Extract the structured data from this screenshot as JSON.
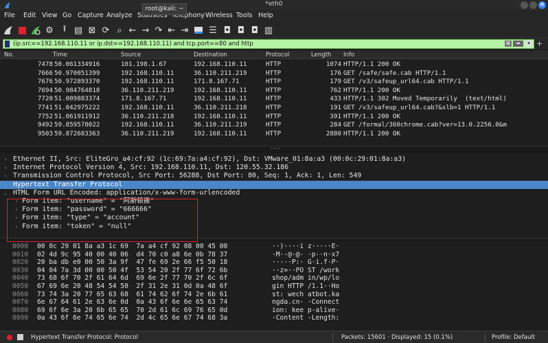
{
  "window": {
    "title": "*eth0",
    "tooltip": "root@kali: ~"
  },
  "menu": [
    "File",
    "Edit",
    "View",
    "Go",
    "Capture",
    "Analyze",
    "Statistics",
    "Telephony",
    "Wireless",
    "Tools",
    "Help"
  ],
  "filter": {
    "value": "(ip.src==192.168.110.11 or ip.dst==192.168.110.11) and tcp.port==80 and http"
  },
  "columns": [
    "No.",
    "Time",
    "Source",
    "Destination",
    "Protocol",
    "Length",
    "Info"
  ],
  "packets": [
    [
      "7478",
      "50.061334916",
      "101.198.1.67",
      "192.168.110.11",
      "HTTP",
      "1074",
      "HTTP/1.1 200 OK"
    ],
    [
      "7666",
      "50.970051399",
      "192.168.110.11",
      "36.110.211.219",
      "HTTP",
      "176",
      "GET /safe/safe.cab HTTP/1.1"
    ],
    [
      "7676",
      "50.972893370",
      "192.168.110.11",
      "171.8.167.71",
      "HTTP",
      "179",
      "GET /v3/safeup_url64.cab HTTP/1.1"
    ],
    [
      "7694",
      "50.984764818",
      "36.110.211.219",
      "192.168.110.11",
      "HTTP",
      "762",
      "HTTP/1.1 200 OK"
    ],
    [
      "7720",
      "51.009883374",
      "171.8.167.71",
      "192.168.110.11",
      "HTTP",
      "433",
      "HTTP/1.1 302 Moved Temporarily  (text/html)"
    ],
    [
      "7741",
      "51.042975222",
      "192.168.110.11",
      "36.110.211.218",
      "HTTP",
      "191",
      "GET /v3/safeup_url64.cab?&slb=1 HTTP/1.1"
    ],
    [
      "7752",
      "51.061911912",
      "36.110.211.218",
      "192.168.110.11",
      "HTTP",
      "391",
      "HTTP/1.1 200 OK"
    ],
    [
      "9492",
      "59.859578022",
      "192.168.110.11",
      "36.110.211.219",
      "HTTP",
      "284",
      "GET /formal/360chrome.cab?ver=13.0.2256.0&m"
    ],
    [
      "9503",
      "59.872683363",
      "36.110.211.219",
      "192.168.110.11",
      "HTTP",
      "2880",
      "HTTP/1.1 200 OK"
    ]
  ],
  "details": [
    {
      "arrow": "›",
      "text": "Ethernet II, Src: EliteGro_a4:cf:92 (1c:69:7a:a4:cf:92), Dst: VMware_01:8a:a3 (00:0c:29:01:8a:a3)"
    },
    {
      "arrow": "›",
      "text": "Internet Protocol Version 4, Src: 192.168.110.11, Dst: 120.55.32.186"
    },
    {
      "arrow": "›",
      "text": "Transmission Control Protocol, Src Port: 56288, Dst Port: 80, Seq: 1, Ack: 1, Len: 549"
    },
    {
      "arrow": "›",
      "text": "Hypertext Transfer Protocol"
    },
    {
      "arrow": "⌄",
      "text": "HTML Form URL Encoded: application/x-www-form-urlencoded"
    },
    {
      "arrow": "›",
      "text": "Form item: \"username\" = \"阿斯顿撒\""
    },
    {
      "arrow": "›",
      "text": "Form item: \"password\" = \"666666\""
    },
    {
      "arrow": "›",
      "text": "Form item: \"type\" = \"account\""
    },
    {
      "arrow": "›",
      "text": "Form item: \"token\" = \"null\""
    }
  ],
  "hex": [
    [
      "0000",
      "00 0c 29 01 8a a3 1c 69  7a a4 cf 92 08 00 45 00",
      "··)····i z·····E·"
    ],
    [
      "0010",
      "02 4d 9c 95 40 00 40 06  d4 70 c0 a8 6e 0b 78 37",
      "·M··@·@· ·p··n·x7"
    ],
    [
      "0020",
      "20 ba db e0 00 50 3a 9f  47 fe 69 2e 66 f5 50 18",
      "·····P:· G·i.f·P·"
    ],
    [
      "0030",
      "04 04 7a 3d 00 00 50 4f  53 54 20 2f 77 6f 72 6b",
      "··z=··PO ST /work"
    ],
    [
      "0040",
      "73 68 6f 70 2f 61 64 6d  69 6e 2f 77 70 2f 6c 6f",
      "shop/adm in/wp/lo"
    ],
    [
      "0050",
      "67 69 6e 20 48 54 54 50  2f 31 2e 31 0d 0a 48 6f",
      "gin HTTP /1.1··Ho"
    ],
    [
      "0060",
      "73 74 3a 20 77 65 63 68  61 74 62 6f 74 2e 6b 61",
      "st: wech atbot.ka"
    ],
    [
      "0070",
      "6e 67 64 61 2e 63 6e 0d  0a 43 6f 6e 6e 65 63 74",
      "ngda.cn· ·Connect"
    ],
    [
      "0080",
      "69 6f 6e 3a 20 6b 65 65  70 2d 61 6c 69 76 65 0d",
      "ion: kee p-alive·"
    ],
    [
      "0090",
      "0a 43 6f 6e 74 65 6e 74  2d 4c 65 6e 67 74 68 3a",
      "·Content -Length:"
    ]
  ],
  "status": {
    "left": "Hypertext Transfer Protocol: Protocol",
    "packets": "Packets: 15601 · Displayed: 15 (0.1%)",
    "profile": "Profile: Default"
  }
}
